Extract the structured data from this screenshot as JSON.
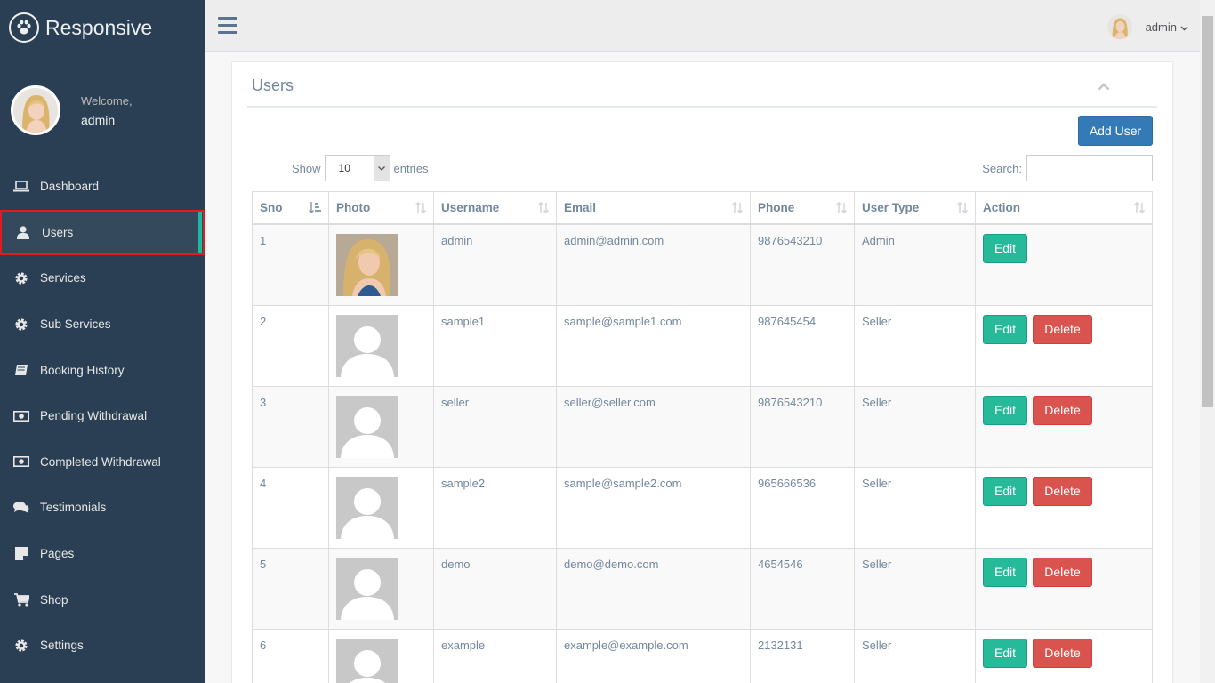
{
  "brand": {
    "name": "Responsive",
    "icon": "paw-icon"
  },
  "profile": {
    "welcome": "Welcome,",
    "name": "admin"
  },
  "sidebar": {
    "items": [
      {
        "label": "Dashboard",
        "icon": "laptop-icon"
      },
      {
        "label": "Users",
        "icon": "user-icon",
        "active": true
      },
      {
        "label": "Services",
        "icon": "gear-icon"
      },
      {
        "label": "Sub Services",
        "icon": "gear-icon"
      },
      {
        "label": "Booking History",
        "icon": "book-icon"
      },
      {
        "label": "Pending Withdrawal",
        "icon": "money-icon"
      },
      {
        "label": "Completed Withdrawal",
        "icon": "money-icon"
      },
      {
        "label": "Testimonials",
        "icon": "comments-icon"
      },
      {
        "label": "Pages",
        "icon": "page-icon"
      },
      {
        "label": "Shop",
        "icon": "cart-icon"
      },
      {
        "label": "Settings",
        "icon": "gear-icon"
      }
    ]
  },
  "topbar": {
    "user": "admin"
  },
  "panel": {
    "title": "Users",
    "add_button": "Add User",
    "show_label": "Show",
    "entries_label": "entries",
    "page_length": "10",
    "search_label": "Search:",
    "search_value": ""
  },
  "table": {
    "columns": [
      "Sno",
      "Photo",
      "Username",
      "Email",
      "Phone",
      "User Type",
      "Action"
    ],
    "edit_label": "Edit",
    "delete_label": "Delete",
    "rows": [
      {
        "sno": "1",
        "photo": "admin-photo",
        "username": "admin",
        "email": "admin@admin.com",
        "phone": "9876543210",
        "type": "Admin"
      },
      {
        "sno": "2",
        "photo": "placeholder",
        "username": "sample1",
        "email": "sample@sample1.com",
        "phone": "987645454",
        "type": "Seller"
      },
      {
        "sno": "3",
        "photo": "placeholder",
        "username": "seller",
        "email": "seller@seller.com",
        "phone": "9876543210",
        "type": "Seller"
      },
      {
        "sno": "4",
        "photo": "placeholder",
        "username": "sample2",
        "email": "sample@sample2.com",
        "phone": "965666536",
        "type": "Seller"
      },
      {
        "sno": "5",
        "photo": "placeholder",
        "username": "demo",
        "email": "demo@demo.com",
        "phone": "4654546",
        "type": "Seller"
      },
      {
        "sno": "6",
        "photo": "placeholder",
        "username": "example",
        "email": "example@example.com",
        "phone": "2132131",
        "type": "Seller"
      }
    ]
  },
  "colors": {
    "sidebar": "#2A3F54",
    "accent": "#1ABB9C",
    "primary": "#337AB7",
    "success": "#26B99A",
    "danger": "#D9534F"
  }
}
